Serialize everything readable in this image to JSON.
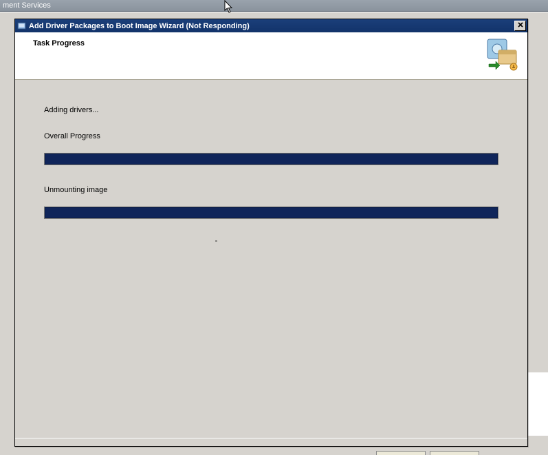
{
  "background": {
    "parent_title_fragment": "ment Services"
  },
  "dialog": {
    "title": "Add Driver Packages to Boot Image Wizard (Not Responding)",
    "header_title": "Task Progress",
    "status_text": "Adding drivers...",
    "overall_label": "Overall Progress",
    "secondary_label": "Unmounting image",
    "dash": "-"
  },
  "progress": {
    "overall_percent": 100,
    "secondary_percent": 100
  },
  "colors": {
    "titlebar": "#12336a",
    "progress_fill": "#10255a"
  }
}
